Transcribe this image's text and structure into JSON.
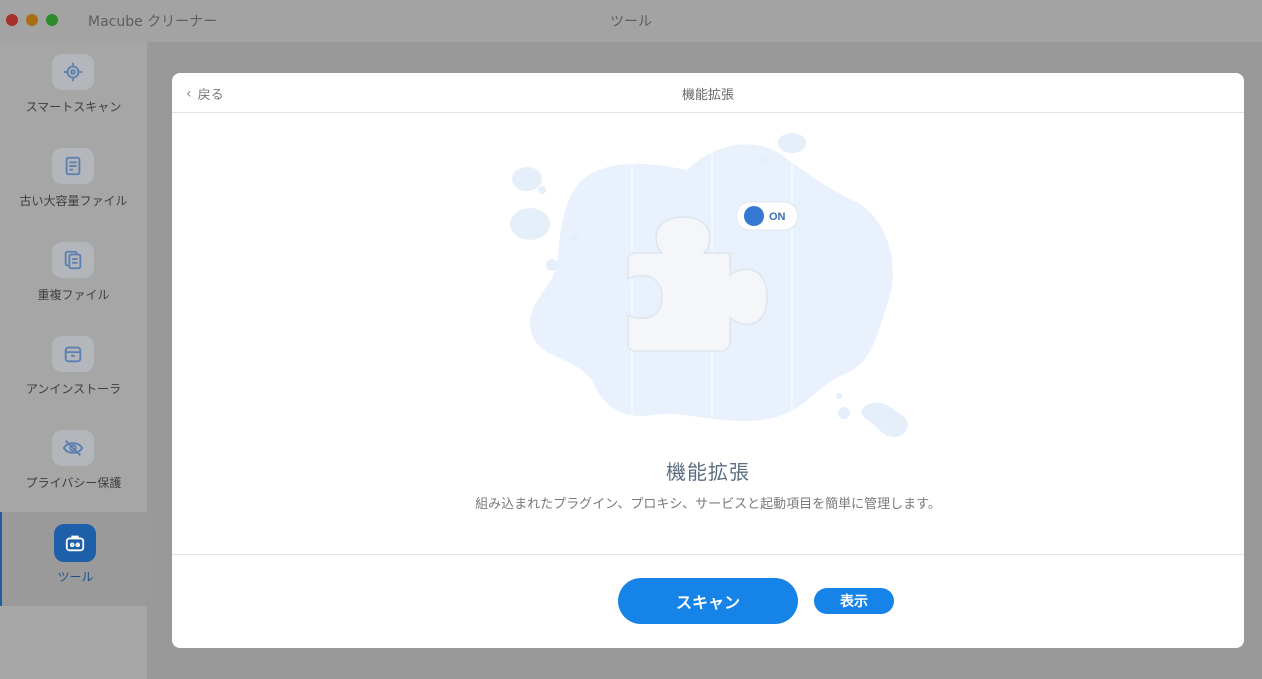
{
  "window": {
    "app_title": "Macube クリーナー",
    "title": "ツール"
  },
  "sidebar": {
    "items": [
      {
        "label": "スマートスキャン",
        "icon": "target-icon"
      },
      {
        "label": "古い大容量ファイル",
        "icon": "document-icon"
      },
      {
        "label": "重複ファイル",
        "icon": "duplicate-files-icon"
      },
      {
        "label": "アンインストーラ",
        "icon": "archive-box-icon"
      },
      {
        "label": "プライバシー保護",
        "icon": "eye-slash-icon"
      },
      {
        "label": "ツール",
        "icon": "toolbox-icon",
        "active": true
      }
    ]
  },
  "dialog": {
    "back_label": "戻る",
    "header_title": "機能拡張",
    "toggle_label": "ON",
    "main_title": "機能拡張",
    "description": "組み込まれたプラグイン、プロキシ、サービスと起動項目を簡単に管理します。",
    "scan_button": "スキャン",
    "show_button": "表示"
  },
  "colors": {
    "accent": "#1683e8",
    "active_sidebar_icon": "#1d5fa8",
    "title_text": "#5d6d80"
  }
}
